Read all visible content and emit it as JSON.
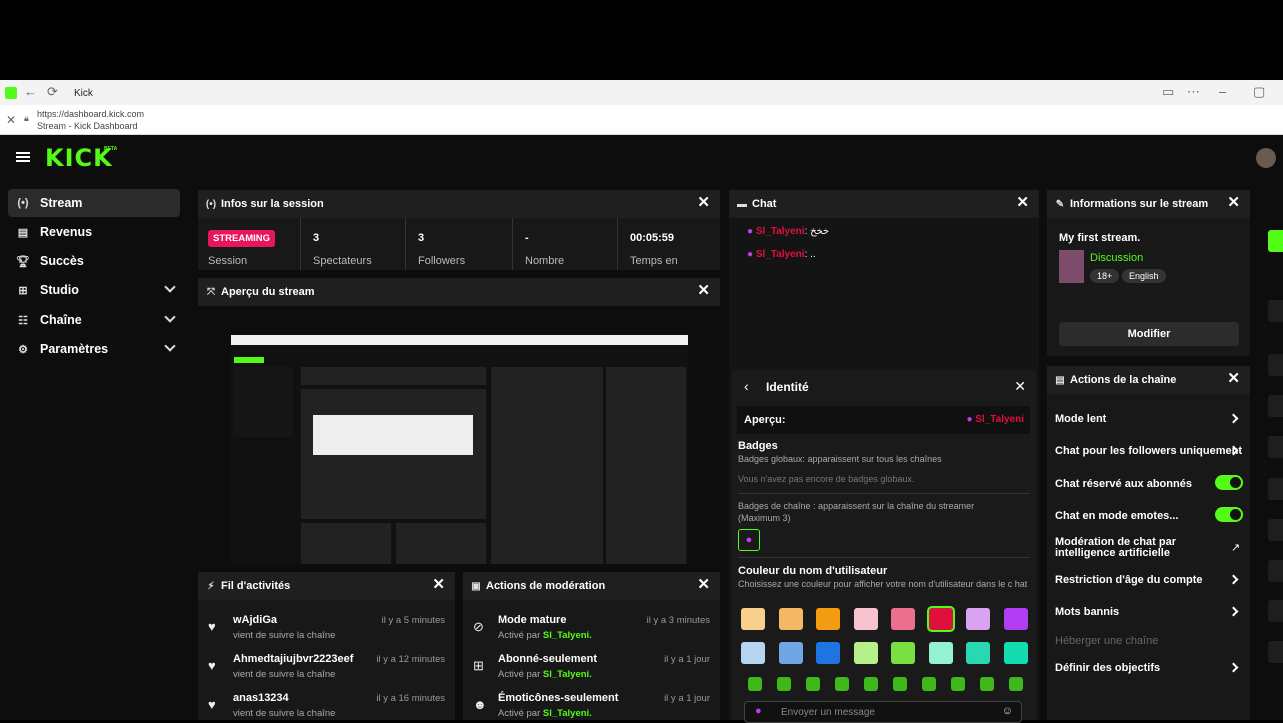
{
  "browser": {
    "tab_title": "Kick",
    "url": "https://dashboard.kick.com",
    "page_title": "Stream - Kick Dashboard"
  },
  "brand": {
    "logo": "KICK",
    "beta": "BETA",
    "accent": "#53fc18",
    "live_red": "#e8175d"
  },
  "sidebar": {
    "items": [
      {
        "label": "Stream",
        "icon": "stream-icon"
      },
      {
        "label": "Revenus",
        "icon": "revenue-icon"
      },
      {
        "label": "Succès",
        "icon": "trophy-icon"
      },
      {
        "label": "Studio",
        "icon": "studio-icon"
      },
      {
        "label": "Chaîne",
        "icon": "channel-icon"
      },
      {
        "label": "Paramètres",
        "icon": "gear-icon"
      }
    ]
  },
  "session": {
    "title": "Infos sur la session",
    "badge": "STREAMING",
    "badge_label": "Session",
    "stats": [
      {
        "value": "3",
        "label": "Spectateurs"
      },
      {
        "value": "3",
        "label": "Followers"
      },
      {
        "value": "-",
        "label": "Nombre"
      },
      {
        "value": "00:05:59",
        "label": "Temps en"
      }
    ]
  },
  "preview": {
    "title": "Aperçu du stream"
  },
  "chat": {
    "title": "Chat",
    "messages": [
      {
        "user": "Sl_Talyeni",
        "text": "خخخ"
      },
      {
        "user": "Sl_Talyeni",
        "text": ".."
      }
    ],
    "input_placeholder": "Envoyer un message"
  },
  "identity": {
    "title": "Identité",
    "preview_label": "Aperçu:",
    "preview_user": "Sl_Talyeni",
    "badges_title": "Badges",
    "badges_global": "Badges globaux: apparaissent sur tous les chaînes",
    "badges_none": "Vous n'avez pas encore de badges globaux.",
    "badges_channel": "Badges de chaîne : apparaissent sur la chaîne du streamer (Maximum 3)",
    "color_title": "Couleur du nom d'utilisateur",
    "color_desc": "Choisissez une couleur pour afficher votre nom d'utilisateur dans le c hat",
    "colors_row1": [
      "#f9cf8e",
      "#f5b766",
      "#f39c12",
      "#f7c3cf",
      "#ec6f8f",
      "#e0103e",
      "#d9a3f2",
      "#b13cf1"
    ],
    "colors_row2": [
      "#b5d4f2",
      "#6ea6e6",
      "#1e74e0",
      "#b7f089",
      "#7ae042",
      "#93f2d0",
      "#2ad7b3",
      "#13ddb0"
    ]
  },
  "stream_info": {
    "title": "Informations sur le stream",
    "stream_title": "My first stream.",
    "category": "Discussion",
    "tags": [
      "18+",
      "English"
    ],
    "edit_button": "Modifier"
  },
  "channel_actions": {
    "title": "Actions de la chaîne",
    "rows": [
      {
        "label": "Mode lent",
        "type": "arrow"
      },
      {
        "label": "Chat pour les followers uniquement",
        "type": "arrow"
      },
      {
        "label": "Chat réservé aux abonnés",
        "type": "toggle"
      },
      {
        "label": "Chat en mode emotes...",
        "type": "toggle"
      },
      {
        "label": "Modération de chat par intelligence artificielle",
        "type": "external"
      },
      {
        "label": "Restriction d'âge du compte",
        "type": "arrow"
      },
      {
        "label": "Mots bannis",
        "type": "arrow"
      },
      {
        "label": "Héberger une chaîne",
        "type": "disabled"
      },
      {
        "label": "Définir des objectifs",
        "type": "arrow"
      }
    ]
  },
  "activity": {
    "title": "Fil d'activités",
    "items": [
      {
        "user": "wAjdiGa",
        "action": "vient de suivre la chaîne",
        "time": "il y a 5 minutes"
      },
      {
        "user": "Ahmedtajiujbvr2223eef",
        "action": "vient de suivre la chaîne",
        "time": "il y a 12 minutes"
      },
      {
        "user": "anas13234",
        "action": "vient de suivre la chaîne",
        "time": "il y a 16 minutes"
      }
    ]
  },
  "moderation": {
    "title": "Actions de modération",
    "activated_by": "Activé par",
    "items": [
      {
        "label": "Mode mature",
        "by": "Sl_Talyeni.",
        "time": "il y a 3 minutes",
        "icon": "eye-off-icon"
      },
      {
        "label": "Abonné-seulement",
        "by": "Sl_Talyeni.",
        "time": "il y a 1 jour",
        "icon": "gift-icon"
      },
      {
        "label": "Émoticônes-seulement",
        "by": "Sl_Talyeni.",
        "time": "il y a 1 jour",
        "icon": "smile-icon"
      }
    ]
  }
}
